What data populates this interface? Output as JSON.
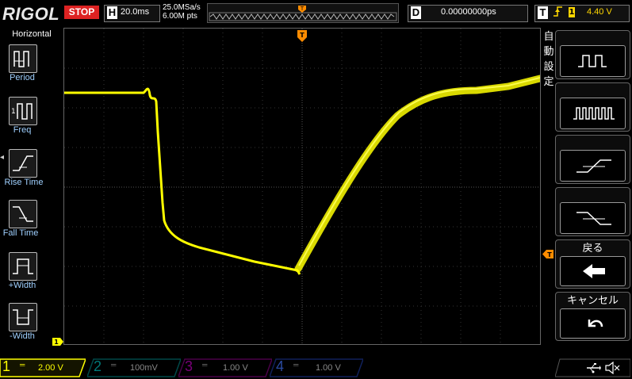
{
  "header": {
    "logo": "RIGOL",
    "run_status": "STOP",
    "timebase_letter": "H",
    "timebase": "20.0ms",
    "sample_rate": "25.0MSa/s",
    "memory_depth": "6.00M pts",
    "delay_letter": "D",
    "delay": "0.00000000ps",
    "trigger_letter": "T",
    "trigger_source": "1",
    "trigger_level": "4.40 V"
  },
  "left_menu": {
    "title": "Horizontal",
    "items": [
      {
        "label": "Period"
      },
      {
        "label": "Freq"
      },
      {
        "label": "Rise Time"
      },
      {
        "label": "Fall Time"
      },
      {
        "label": "+Width"
      },
      {
        "label": "-Width"
      }
    ]
  },
  "right_menu": {
    "title_chars": [
      "自",
      "動",
      "設",
      "定"
    ],
    "back_label": "戻る",
    "cancel_label": "キャンセル"
  },
  "channels": [
    {
      "num": "1",
      "value": "2.00 V",
      "color": "#ffff00"
    },
    {
      "num": "2",
      "value": "100mV",
      "color": "#00c0c0"
    },
    {
      "num": "3",
      "value": "1.00 V",
      "color": "#c000c0"
    },
    {
      "num": "4",
      "value": "1.00 V",
      "color": "#3366ff"
    }
  ],
  "markers": {
    "trigger_pos": "T",
    "ch1_ground": "1"
  },
  "colors": {
    "ch1": "#ffff00",
    "trigger": "#ff8c00",
    "stop": "#dd2222"
  }
}
